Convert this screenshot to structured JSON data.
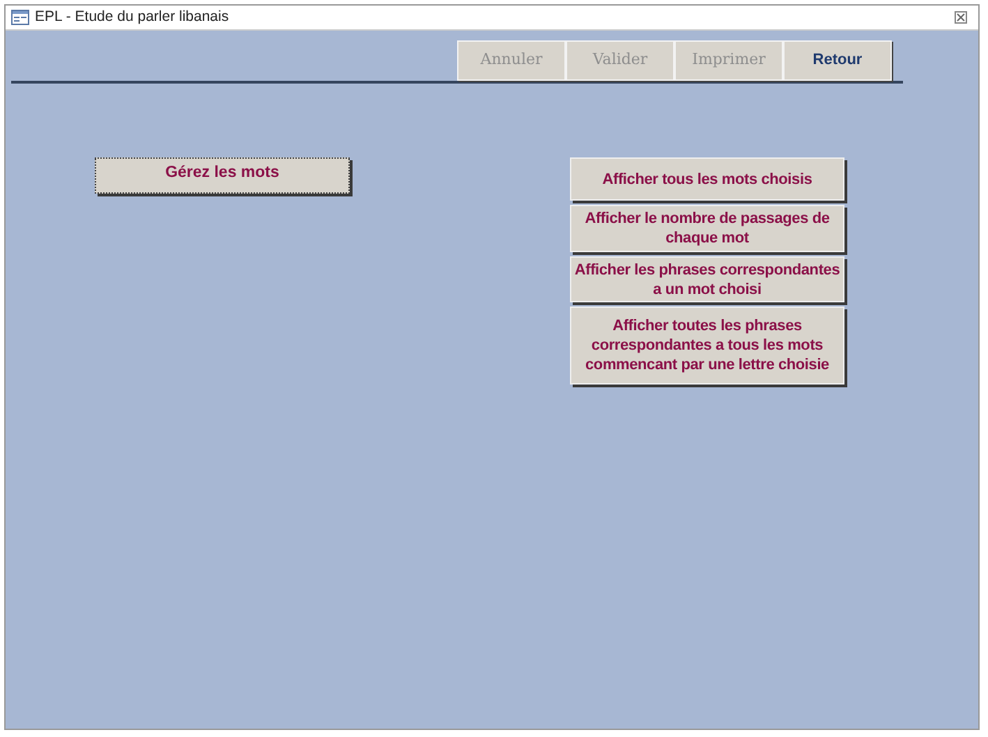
{
  "window": {
    "title": "EPL - Etude du parler libanais"
  },
  "toolbar": [
    {
      "label": "Annuler",
      "disabled": true
    },
    {
      "label": "Valider",
      "disabled": true
    },
    {
      "label": "Imprimer",
      "disabled": true
    },
    {
      "label": "Retour",
      "disabled": false
    }
  ],
  "left_buttons": [
    {
      "label": "Gérez les mots",
      "focused": true
    }
  ],
  "right_buttons": [
    {
      "label": "Afficher tous les mots choisis",
      "focused": false
    },
    {
      "label": "Afficher le nombre de passages de chaque mot",
      "focused": false
    },
    {
      "label": "Afficher les phrases correspondantes a un mot choisi",
      "focused": false
    },
    {
      "label": "Afficher toutes les phrases correspondantes a tous les mots commencant par une lettre choisie",
      "focused": false
    }
  ]
}
